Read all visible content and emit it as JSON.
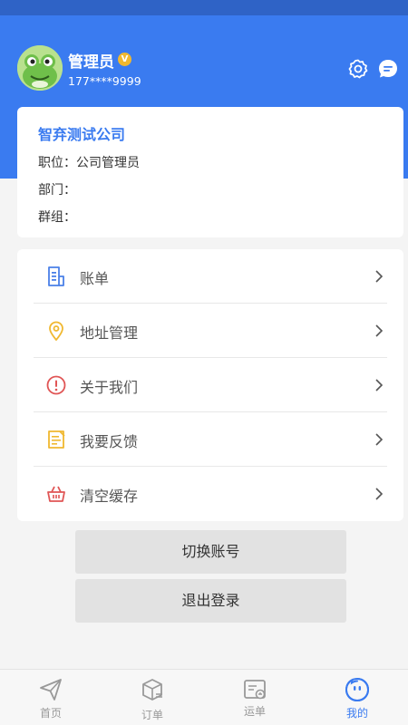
{
  "user": {
    "name": "管理员",
    "badge": "V",
    "phone": "177****9999",
    "badge_color": "#f0b830"
  },
  "company": {
    "name": "智弃测试公司",
    "position": "职位：公司管理员",
    "department": "部门：",
    "group": "群组："
  },
  "menu": {
    "items": [
      {
        "label": "账单",
        "icon": "bill-icon"
      },
      {
        "label": "地址管理",
        "icon": "location-pin-icon"
      },
      {
        "label": "关于我们",
        "icon": "info-exclamation-icon"
      },
      {
        "label": "我要反馈",
        "icon": "feedback-note-icon"
      },
      {
        "label": "清空缓存",
        "icon": "basket-icon"
      }
    ]
  },
  "buttons": {
    "switch_account": "切换账号",
    "logout": "退出登录"
  },
  "bottom_nav": {
    "items": [
      {
        "label": "首页",
        "icon": "paper-plane-icon",
        "active": false
      },
      {
        "label": "订单",
        "icon": "box-icon",
        "active": false
      },
      {
        "label": "运单",
        "icon": "waybill-icon",
        "active": false
      },
      {
        "label": "我的",
        "icon": "smile-face-icon",
        "active": true
      }
    ]
  },
  "colors": {
    "accent": "#3a7bf0",
    "status_bar": "#2f63c6",
    "background": "#f4f4f4"
  }
}
